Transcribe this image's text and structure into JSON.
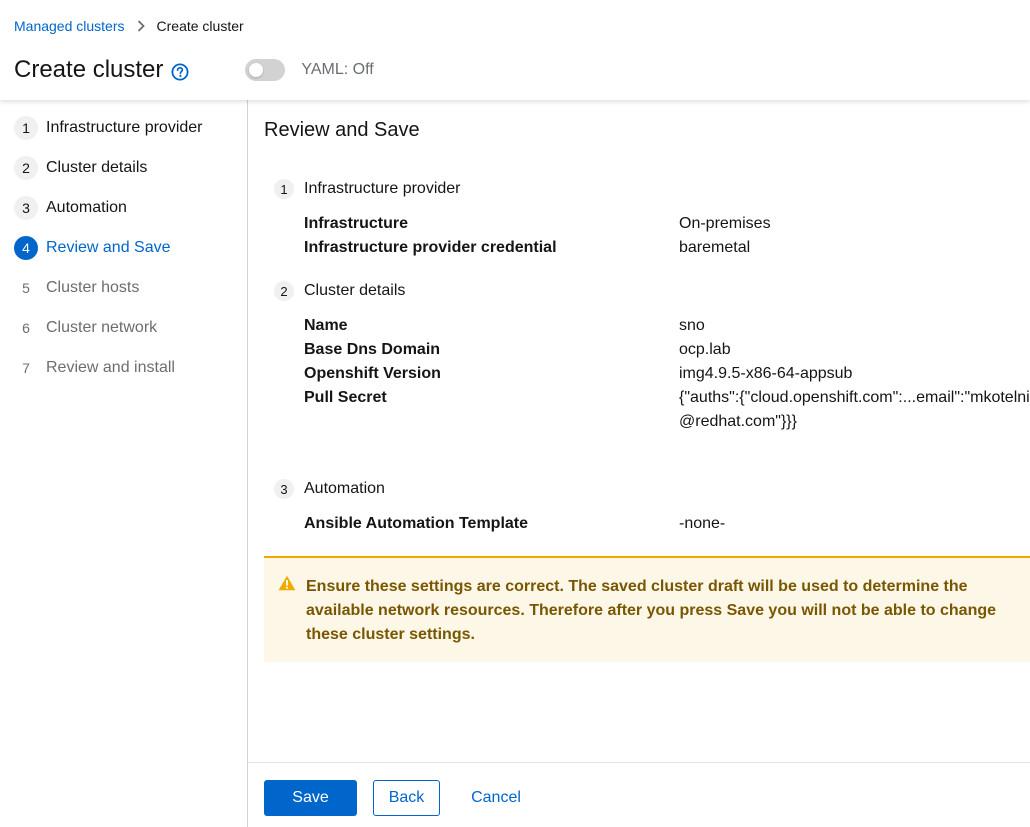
{
  "breadcrumb": {
    "parent": "Managed clusters",
    "current": "Create cluster"
  },
  "header": {
    "title": "Create cluster",
    "yaml_label": "YAML: Off",
    "yaml_on": false
  },
  "wizard_nav": [
    {
      "num": "1",
      "label": "Infrastructure provider",
      "state": "done"
    },
    {
      "num": "2",
      "label": "Cluster details",
      "state": "done"
    },
    {
      "num": "3",
      "label": "Automation",
      "state": "done"
    },
    {
      "num": "4",
      "label": "Review and Save",
      "state": "current"
    },
    {
      "num": "5",
      "label": "Cluster hosts",
      "state": "disabled"
    },
    {
      "num": "6",
      "label": "Cluster network",
      "state": "disabled"
    },
    {
      "num": "7",
      "label": "Review and install",
      "state": "disabled"
    }
  ],
  "review": {
    "title": "Review and Save",
    "sections": [
      {
        "num": "1",
        "title": "Infrastructure provider",
        "fields": [
          {
            "key": "Infrastructure",
            "value": "On-premises"
          },
          {
            "key": "Infrastructure provider credential",
            "value": "baremetal"
          }
        ]
      },
      {
        "num": "2",
        "title": "Cluster details",
        "fields": [
          {
            "key": "Name",
            "value": "sno"
          },
          {
            "key": "Base Dns Domain",
            "value": "ocp.lab"
          },
          {
            "key": "Openshift Version",
            "value": "img4.9.5-x86-64-appsub"
          },
          {
            "key": "Pull Secret",
            "value": "{\"auths\":{\"cloud.openshift.com\":...email\":\"mkotelni@redhat.com\"}}}"
          }
        ]
      },
      {
        "num": "3",
        "title": "Automation",
        "fields": [
          {
            "key": "Ansible Automation Template",
            "value": "-none-"
          }
        ]
      }
    ]
  },
  "alert": {
    "text": "Ensure these settings are correct. The saved cluster draft will be used to determine the available network resources. Therefore after you press Save you will not be able to change these cluster settings."
  },
  "footer": {
    "save": "Save",
    "back": "Back",
    "cancel": "Cancel"
  },
  "colors": {
    "accent": "#0066cc",
    "warning": "#f0ab00",
    "warning_bg": "#fdf7e7"
  }
}
